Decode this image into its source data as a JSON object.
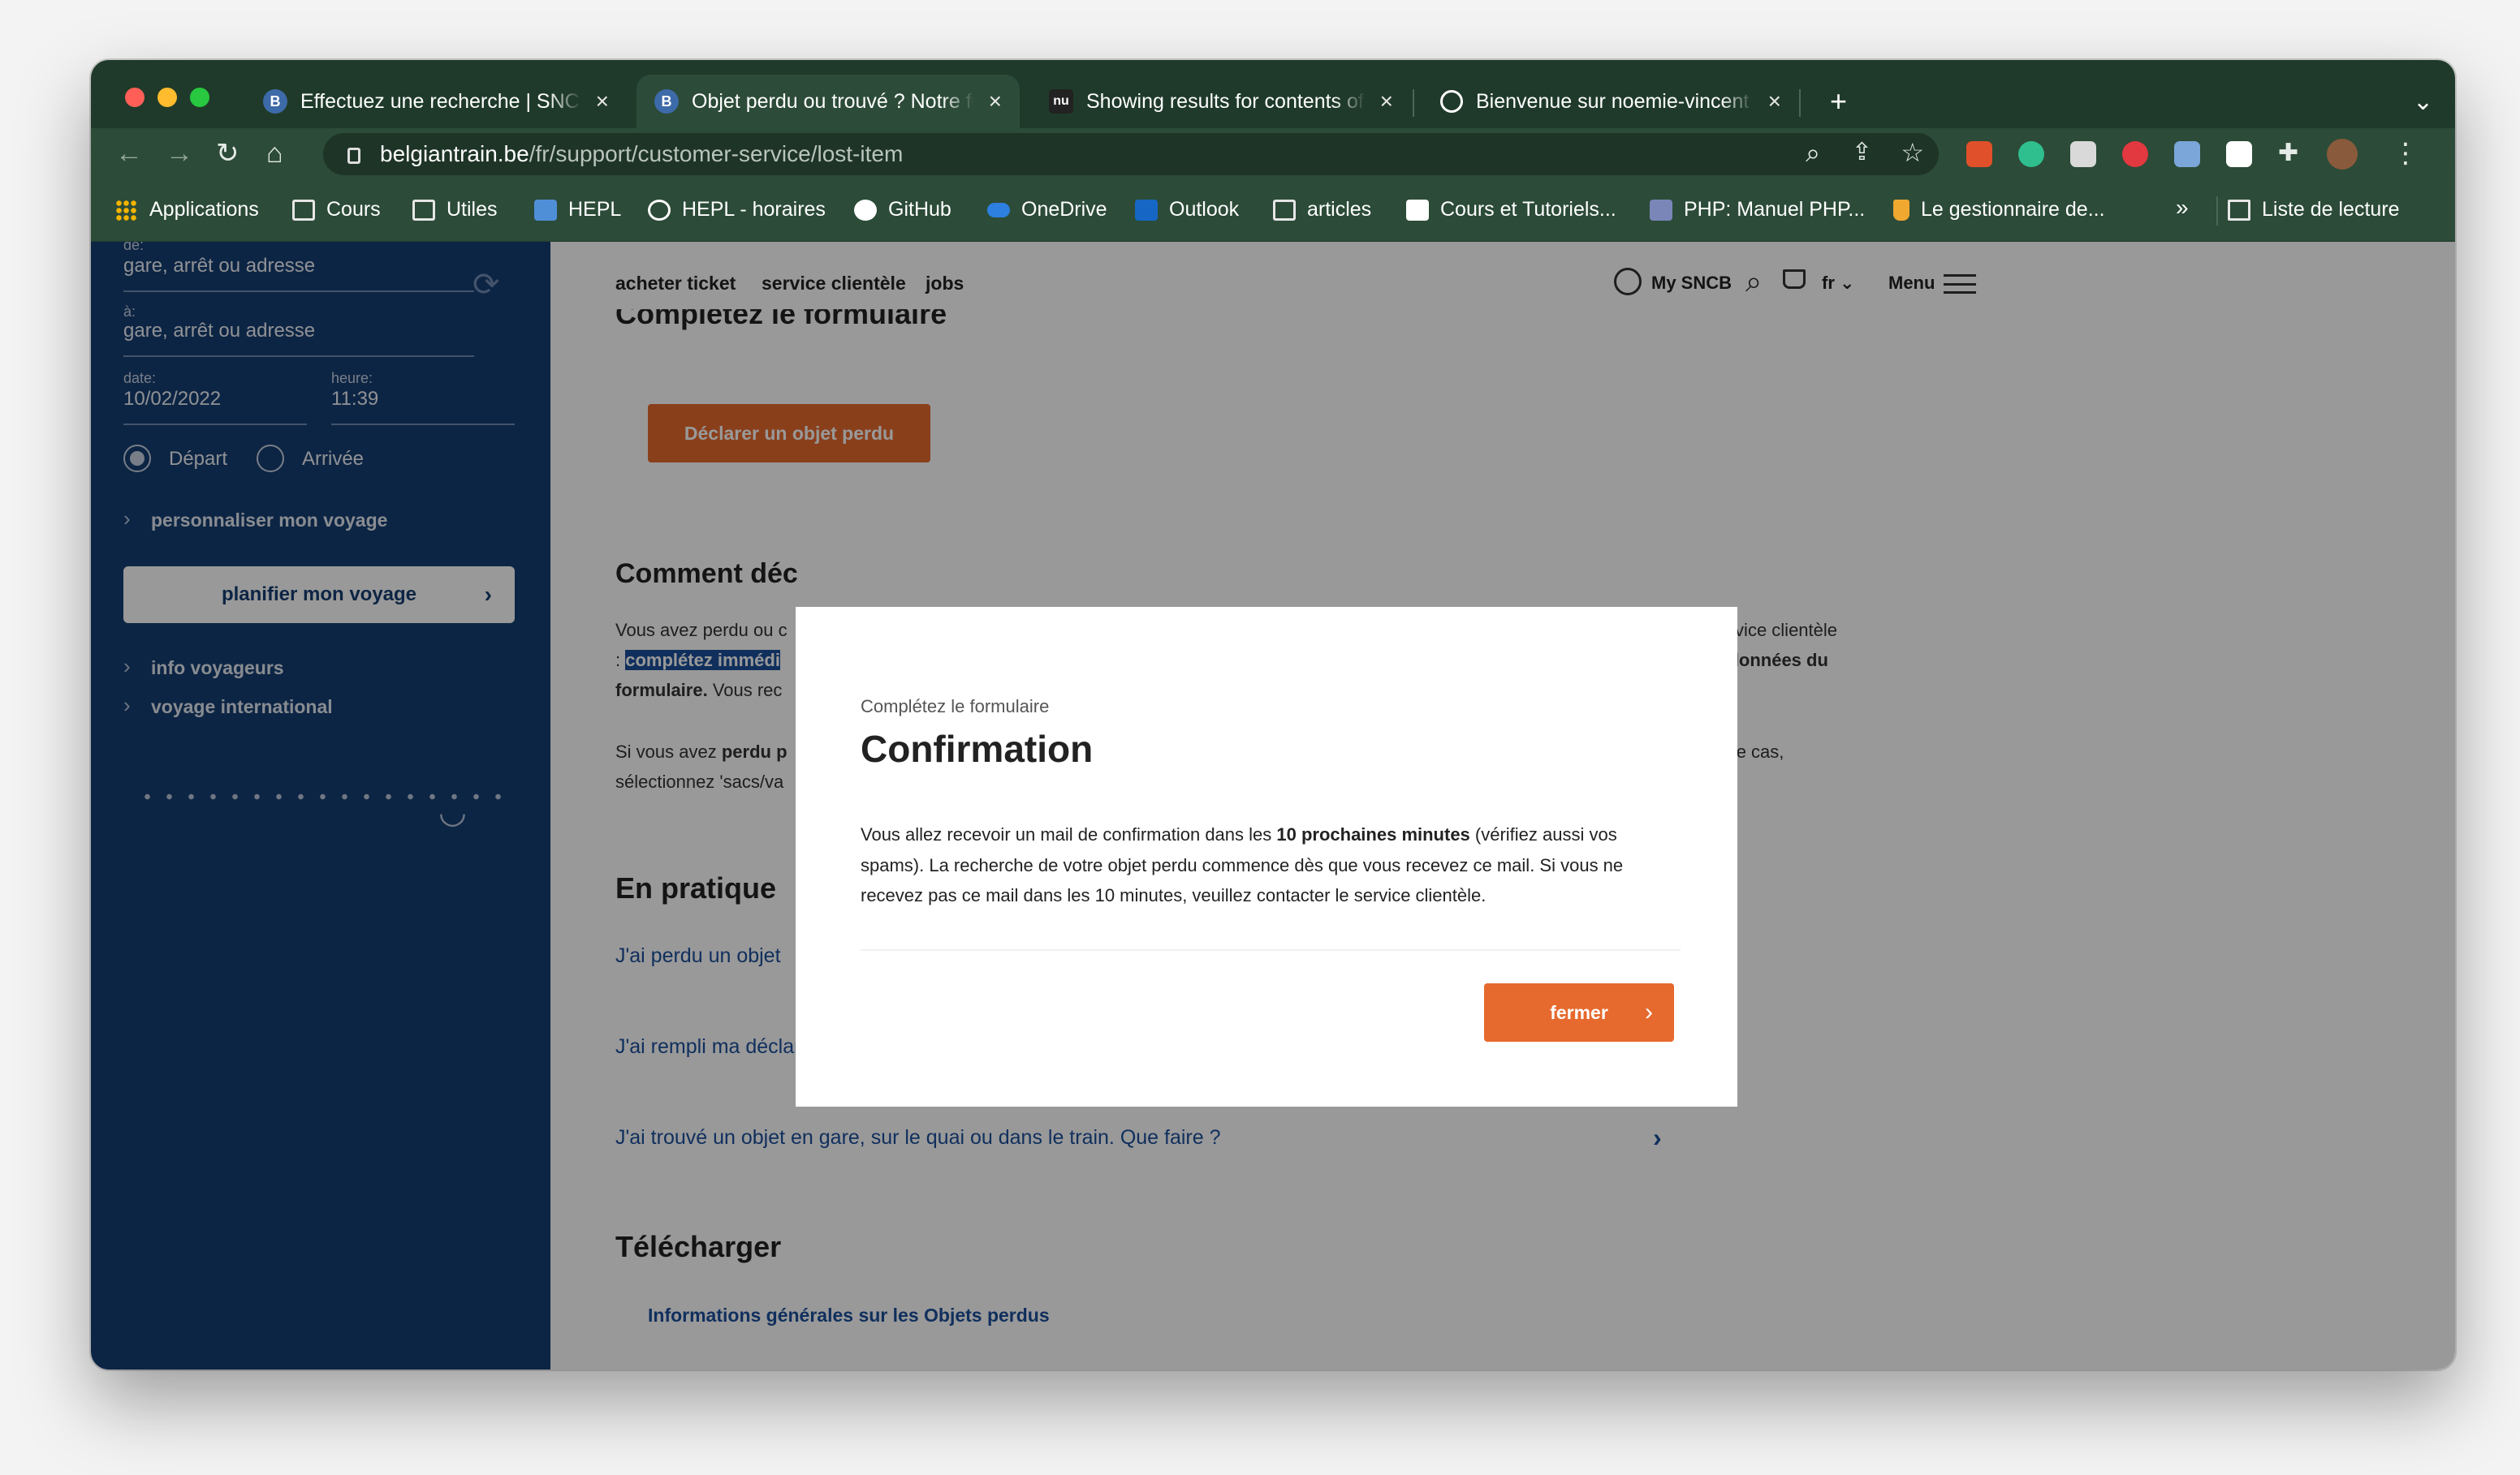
{
  "browser": {
    "tabs": [
      {
        "favicon": "B",
        "title": "Effectuez une recherche | SNCB",
        "close": "×",
        "active": false
      },
      {
        "favicon": "B",
        "title": "Objet perdu ou trouvé ? Notre formulaire",
        "close": "×",
        "active": true
      },
      {
        "favicon": "nu",
        "title": "Showing results for contents of",
        "close": "×",
        "active": false
      },
      {
        "favicon": "globe-icon",
        "title": "Bienvenue sur noemie-vincent",
        "close": "×",
        "active": false
      }
    ],
    "new_tab": "+",
    "tab_menu": "⌄",
    "url_host": "belgiantrain.be",
    "url_path": "/fr/support/customer-service/lost-item",
    "bookmarks": [
      {
        "icon": "apps-grid-icon",
        "label": "Applications"
      },
      {
        "icon": "folder-icon",
        "label": "Cours"
      },
      {
        "icon": "folder-icon",
        "label": "Utiles"
      },
      {
        "icon": "hepl-icon",
        "label": "HEPL"
      },
      {
        "icon": "globe-icon",
        "label": "HEPL - horaires"
      },
      {
        "icon": "github-icon",
        "label": "GitHub"
      },
      {
        "icon": "onedrive-icon",
        "label": "OneDrive"
      },
      {
        "icon": "outlook-icon",
        "label": "Outlook"
      },
      {
        "icon": "folder-icon",
        "label": "articles"
      },
      {
        "icon": "sql-icon",
        "label": "Cours et Tutoriels..."
      },
      {
        "icon": "php-icon",
        "label": "PHP: Manuel PHP..."
      },
      {
        "icon": "beer-icon",
        "label": "Le gestionnaire de..."
      }
    ],
    "bookmarks_more": "»",
    "reading_list": "Liste de lecture"
  },
  "sidebar": {
    "from_label": "de:",
    "from_placeholder": "gare, arrêt ou adresse",
    "to_label": "à:",
    "to_placeholder": "gare, arrêt ou adresse",
    "date_label": "date:",
    "date_value": "10/02/2022",
    "time_label": "heure:",
    "time_value": "11:39",
    "departure": "Départ",
    "arrival": "Arrivée",
    "customize": "personnaliser mon voyage",
    "plan_button": "planifier mon voyage",
    "info": "info voyageurs",
    "international": "voyage international"
  },
  "site_nav": {
    "buy": "acheter ticket",
    "service": "service clientèle",
    "jobs": "jobs",
    "account": "My SNCB",
    "lang": "fr",
    "menu": "Menu"
  },
  "content": {
    "form_heading": "Complétez le formulaire",
    "declare_button": "Déclarer un objet perdu",
    "how_heading": "Comment déc",
    "para1_l1a": "Vous avez perdu ou c",
    "para1_l1b": "ner au service clientèle",
    "para1_l2a": ": ",
    "para1_l2hl": "complétez immédi",
    "para1_l2b": "tion des données ",
    "para1_l2bold": "du",
    "para1_l3bold": "formulaire.",
    "para1_l3": " Vous rec",
    "para2_l1a": "Si vous avez ",
    "para2_l1bold": "perdu p",
    "para2_l1b": ". Dans ce cas,",
    "para2_l2": "sélectionnez 'sacs/va",
    "practice_heading": "En pratique",
    "faq": [
      "J'ai perdu un objet",
      "J'ai rempli ma déclaration de perte. Que se passe-t-il ensuite ?",
      "J'ai trouvé un objet en gare, sur le quai ou dans le train. Que faire ?"
    ],
    "download_heading": "Télécharger",
    "download_link": "Informations générales sur les Objets perdus"
  },
  "modal": {
    "kicker": "Complétez le formulaire",
    "title": "Confirmation",
    "body_1": "Vous allez recevoir un mail de confirmation dans les ",
    "body_bold": "10 prochaines minutes",
    "body_2": " (vérifiez aussi vos spams). La recherche de votre objet perdu commence dès que vous recevez ce mail. Si vous ne recevez pas ce mail dans les 10 minutes, veuillez contacter le service clientèle.",
    "close_button": "fermer"
  },
  "colors": {
    "sidebar": "#173e72",
    "accent": "#e6692d",
    "link": "#1b4f9c",
    "chrome": "#2c4b38"
  }
}
